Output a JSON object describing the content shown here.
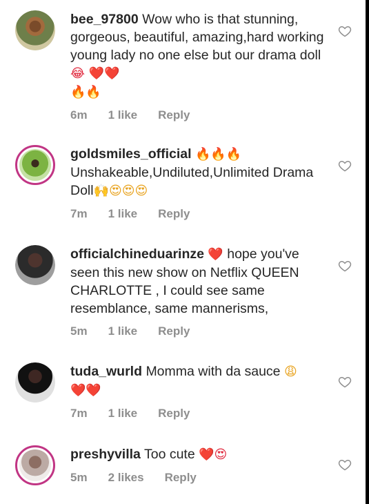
{
  "comments": [
    {
      "username": "bee_97800",
      "text": "Wow who is that stunning, gorgeous, beautiful, amazing,hard working young lady no one else but our drama doll ",
      "emoji_trail": "😂 ❤️❤️",
      "emoji_line2": "🔥🔥",
      "time": "6m",
      "likes": "1 like",
      "reply": "Reply"
    },
    {
      "username": "goldsmiles_official",
      "emoji_after_user": "🔥🔥🔥",
      "text": "Unshakeable,Undiluted,Unlimited Drama Doll",
      "emoji_trail": "🙌😍😍😍",
      "time": "7m",
      "likes": "1 like",
      "reply": "Reply"
    },
    {
      "username": "officialchineduarinze",
      "emoji_after_user": "❤️",
      "text": "hope you've seen this new show on Netflix QUEEN CHARLOTTE , I could see same resemblance, same mannerisms,",
      "time": "5m",
      "likes": "1 like",
      "reply": "Reply"
    },
    {
      "username": "tuda_wurld",
      "text": "Momma with da sauce ",
      "emoji_trail": "😩",
      "emoji_line2": "❤️❤️",
      "time": "7m",
      "likes": "1 like",
      "reply": "Reply"
    },
    {
      "username": "preshyvilla",
      "text": "Too cute ",
      "emoji_trail": "❤️😍",
      "time": "5m",
      "likes": "2 likes",
      "reply": "Reply"
    }
  ],
  "colors": {
    "text": "#262626",
    "meta": "#8e8e8e",
    "heart": "#e0263b",
    "story_ring": "#c13584"
  },
  "icons": {
    "like": "heart-outline-icon"
  }
}
